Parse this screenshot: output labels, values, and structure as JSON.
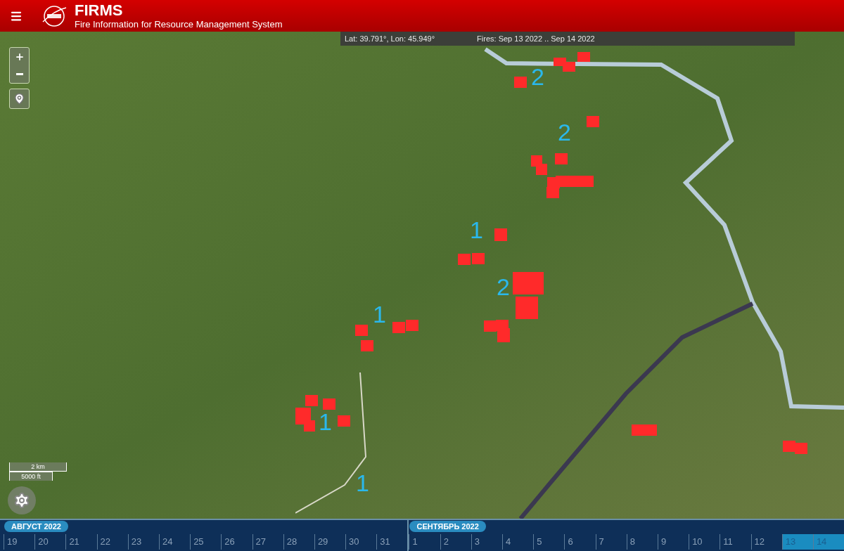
{
  "header": {
    "title": "FIRMS",
    "subtitle": "Fire Information for Resource Management System"
  },
  "info_bar": {
    "coordinates": "Lat: 39.791°, Lon: 45.949°",
    "fires_range": "Fires: Sep 13 2022 .. Sep 14 2022"
  },
  "map_labels": [
    "2",
    "2",
    "1",
    "2",
    "1",
    "1",
    "1"
  ],
  "scale": {
    "metric": "2 km",
    "imperial": "5000 ft"
  },
  "timeline": [
    {
      "month": "АВГУСТ 2022",
      "days": [
        {
          "label": "19",
          "selected": false
        },
        {
          "label": "20",
          "selected": false
        },
        {
          "label": "21",
          "selected": false
        },
        {
          "label": "22",
          "selected": false
        },
        {
          "label": "23",
          "selected": false
        },
        {
          "label": "24",
          "selected": false
        },
        {
          "label": "25",
          "selected": false
        },
        {
          "label": "26",
          "selected": false
        },
        {
          "label": "27",
          "selected": false
        },
        {
          "label": "28",
          "selected": false
        },
        {
          "label": "29",
          "selected": false
        },
        {
          "label": "30",
          "selected": false
        },
        {
          "label": "31",
          "selected": false
        }
      ]
    },
    {
      "month": "СЕНТЯБРЬ 2022",
      "days": [
        {
          "label": "1",
          "selected": false
        },
        {
          "label": "2",
          "selected": false
        },
        {
          "label": "3",
          "selected": false
        },
        {
          "label": "4",
          "selected": false
        },
        {
          "label": "5",
          "selected": false
        },
        {
          "label": "6",
          "selected": false
        },
        {
          "label": "7",
          "selected": false
        },
        {
          "label": "8",
          "selected": false
        },
        {
          "label": "9",
          "selected": false
        },
        {
          "label": "10",
          "selected": false
        },
        {
          "label": "11",
          "selected": false
        },
        {
          "label": "12",
          "selected": false
        },
        {
          "label": "13",
          "selected": true
        },
        {
          "label": "14",
          "selected": true
        }
      ]
    }
  ]
}
